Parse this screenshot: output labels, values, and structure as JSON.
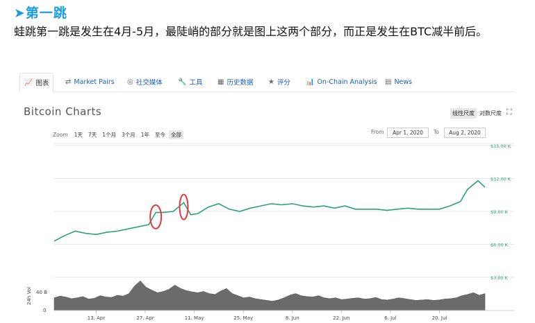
{
  "heading": "➤第一跳",
  "paragraph": "蛙跳第一跳是发生在4月-5月，最陡峭的部分就是图上这两个部分，而正是发生在BTC减半前后。",
  "tabs": [
    {
      "icon": "chart-icon",
      "glyph": "📈",
      "label": "图表",
      "active": true
    },
    {
      "icon": "exchange-icon",
      "glyph": "⇄",
      "label": "Market Pairs"
    },
    {
      "icon": "globe-icon",
      "glyph": "◎",
      "label": "社交媒体"
    },
    {
      "icon": "wrench-icon",
      "glyph": "🔧",
      "label": "工具"
    },
    {
      "icon": "calendar-icon",
      "glyph": "▦",
      "label": "历史数据"
    },
    {
      "icon": "star-icon",
      "glyph": "★",
      "label": "评分"
    },
    {
      "icon": "onchain-icon",
      "glyph": "📊",
      "label": "On-Chain Analysis"
    },
    {
      "icon": "news-icon",
      "glyph": "▤",
      "label": "News"
    }
  ],
  "chart_title": "Bitcoin Charts",
  "scale_options": [
    "线性尺度",
    "对数尺度"
  ],
  "selected_scale": "线性尺度",
  "expand_icon": "expand-icon",
  "zoom_label": "Zoom",
  "zoom_options": [
    "1天",
    "7天",
    "1个月",
    "3个月",
    "1年",
    "至今",
    "全部"
  ],
  "selected_zoom": "全部",
  "range": {
    "from_label": "From",
    "from": "Apr 1, 2020",
    "to_label": "To",
    "to": "Aug 2, 2020"
  },
  "colors": {
    "line": "#2aa372",
    "volume": "#6b6b6b",
    "highlight": "#e03a3a",
    "accent": "#1a9ee0"
  },
  "chart_data": {
    "type": "line",
    "y_ticks": [
      "$3.00 K",
      "$6.00 K",
      "$9.00 K",
      "$12.00 K",
      "$15.00 K"
    ],
    "y_values": [
      3000,
      6000,
      9000,
      12000,
      15000
    ],
    "ylim": [
      3000,
      15000
    ],
    "x_ticks": [
      "13. Apr",
      "27. Apr",
      "11. May",
      "25. May",
      "8. Jun",
      "22. Jun",
      "6. Jul",
      "20. Jul"
    ],
    "xlim": [
      "2020-04-01",
      "2020-08-02"
    ],
    "series": [
      {
        "x": [
          "2020-04-01",
          "2020-04-04",
          "2020-04-07",
          "2020-04-10",
          "2020-04-13",
          "2020-04-16",
          "2020-04-19",
          "2020-04-22",
          "2020-04-25",
          "2020-04-28",
          "2020-04-30",
          "2020-05-02",
          "2020-05-05",
          "2020-05-08",
          "2020-05-10",
          "2020-05-12",
          "2020-05-15",
          "2020-05-18",
          "2020-05-21",
          "2020-05-24",
          "2020-05-27",
          "2020-05-30",
          "2020-06-02",
          "2020-06-05",
          "2020-06-08",
          "2020-06-11",
          "2020-06-14",
          "2020-06-17",
          "2020-06-20",
          "2020-06-23",
          "2020-06-26",
          "2020-06-29",
          "2020-07-02",
          "2020-07-05",
          "2020-07-08",
          "2020-07-11",
          "2020-07-14",
          "2020-07-17",
          "2020-07-20",
          "2020-07-23",
          "2020-07-26",
          "2020-07-28",
          "2020-07-31",
          "2020-08-02"
        ],
        "y": [
          6300,
          6800,
          7200,
          7000,
          6900,
          7100,
          7200,
          7400,
          7600,
          7800,
          8900,
          8900,
          9000,
          9800,
          8700,
          8800,
          9400,
          9700,
          9200,
          9000,
          9300,
          9500,
          9700,
          9600,
          9700,
          9500,
          9400,
          9500,
          9300,
          9500,
          9200,
          9200,
          9200,
          9100,
          9200,
          9300,
          9200,
          9200,
          9200,
          9500,
          9900,
          11000,
          11800,
          11200
        ]
      }
    ],
    "volume_label": "24h Vol",
    "volume_tick": "40 B",
    "volume_zero": "0",
    "volume_values": [
      30,
      34,
      32,
      28,
      30,
      33,
      27,
      29,
      35,
      32,
      31,
      36,
      34,
      40,
      58,
      70,
      55,
      48,
      42,
      45,
      50,
      60,
      52,
      47,
      44,
      42,
      45,
      40,
      38,
      46,
      52,
      40,
      35,
      30,
      32,
      28,
      26,
      24,
      22,
      25,
      30,
      36,
      40,
      35,
      33,
      32,
      35,
      30,
      28,
      30,
      26,
      27,
      29,
      30,
      27,
      28,
      31,
      26,
      25,
      27,
      30,
      28,
      26,
      24,
      25,
      26,
      24,
      25,
      27,
      28,
      30,
      35,
      38,
      42,
      36,
      40
    ],
    "volume_ylim": [
      0,
      75
    ],
    "annotations": [
      "red-ellipse-april-jump",
      "red-ellipse-may-halving"
    ]
  }
}
